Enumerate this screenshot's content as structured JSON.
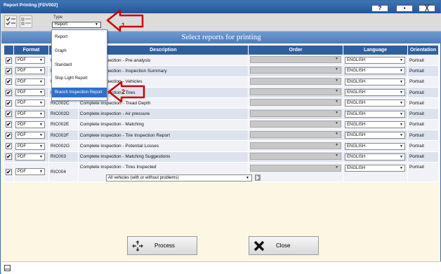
{
  "window": {
    "title": "Report Printing [FDV002]",
    "help_label": "?",
    "close_label": "╳"
  },
  "toolbar": {
    "type_label": "Type",
    "type_value": "Report"
  },
  "type_dropdown": {
    "options": [
      "Report",
      "Graph",
      "Standard",
      "Stop Light Report",
      "Branch Inspection Report"
    ],
    "selected_index": 4
  },
  "banner": {
    "title": "Select reports for printing"
  },
  "table": {
    "headers": [
      "",
      "Format",
      "",
      "Description",
      "Order",
      "Language",
      "Orientation"
    ],
    "rows": [
      {
        "checked": true,
        "format": "PDF",
        "code": "R",
        "description": "Complete inspection - Pre-analysis",
        "language": "ENGLISH",
        "orientation": "Portrait"
      },
      {
        "checked": true,
        "format": "PDF",
        "code": "R",
        "description": "Complete inspection - Inspection Summary",
        "language": "ENGLISH",
        "orientation": "Portrait"
      },
      {
        "checked": true,
        "format": "PDF",
        "code": "R",
        "description": "Complete inspection - Vehicles",
        "language": "ENGLISH",
        "orientation": "Portrait"
      },
      {
        "checked": true,
        "format": "PDF",
        "code": "R",
        "description": "Complete inspection - Tires",
        "language": "ENGLISH",
        "orientation": "Portrait"
      },
      {
        "checked": true,
        "format": "PDF",
        "code": "RIC002C",
        "description": "Complete inspection - Tread Depth",
        "language": "ENGLISH",
        "orientation": "Portrait"
      },
      {
        "checked": true,
        "format": "PDF",
        "code": "RIC002D",
        "description": "Complete inspection - Air pressure",
        "language": "ENGLISH",
        "orientation": "Portrait"
      },
      {
        "checked": true,
        "format": "PDF",
        "code": "RIC002E",
        "description": "Complete inspection - Matching",
        "language": "ENGLISH",
        "orientation": "Portrait"
      },
      {
        "checked": true,
        "format": "PDF",
        "code": "RIC002F",
        "description": "Complete inspection - Tire Inspection Report",
        "language": "ENGLISH",
        "orientation": "Portrait"
      },
      {
        "checked": true,
        "format": "PDF",
        "code": "RIC002G",
        "description": "Complete inspection - Potential Losses",
        "language": "ENGLISH",
        "orientation": "Portrait"
      },
      {
        "checked": true,
        "format": "PDF",
        "code": "RIC003",
        "description": "Complete inspection - Matching Suggestions",
        "language": "ENGLISH",
        "orientation": "Portrait"
      },
      {
        "checked": true,
        "format": "PDF",
        "code": "RIC004",
        "description": "Complete inspection - Tires Inspected",
        "language": "ENGLISH",
        "orientation": "Portrait",
        "sub_filter": "All vehicles (with or without problems)"
      }
    ]
  },
  "callouts": [
    "1",
    "2"
  ],
  "actions": {
    "process_label": "Process",
    "close_label": "Close"
  },
  "colors": {
    "header": "#305f9f",
    "banner": "#5a87c4",
    "callout": "#cc0000",
    "window_bg": "#fcf6e2"
  }
}
